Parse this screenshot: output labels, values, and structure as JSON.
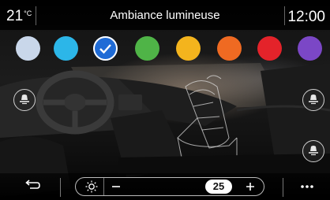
{
  "status_bar": {
    "temperature": "21",
    "temperature_unit": "°C",
    "title": "Ambiance lumineuse",
    "clock": "12:00"
  },
  "color_swatches": [
    {
      "name": "pale-blue",
      "color": "#c9d7ea",
      "selected": false
    },
    {
      "name": "cyan",
      "color": "#2cb6e8",
      "selected": false
    },
    {
      "name": "blue",
      "color": "#1f6bd6",
      "selected": true
    },
    {
      "name": "green",
      "color": "#4fb447",
      "selected": false
    },
    {
      "name": "yellow",
      "color": "#f4b41d",
      "selected": false
    },
    {
      "name": "orange",
      "color": "#ef6a22",
      "selected": false
    },
    {
      "name": "red",
      "color": "#e4232a",
      "selected": false
    },
    {
      "name": "purple",
      "color": "#7b47c6",
      "selected": false
    }
  ],
  "side_buttons": {
    "left": "ceiling-light-icon",
    "right_top": "ceiling-light-icon",
    "right_bottom": "ceiling-light-icon"
  },
  "brightness": {
    "icon": "sun-icon",
    "value": "25",
    "level": 0.25
  },
  "bottom_bar": {
    "back_icon": "back-arrow-icon",
    "minus_icon": "minus-icon",
    "plus_icon": "plus-icon",
    "more_icon": "more-icon"
  },
  "colors": {
    "accent": "#1f6bd6",
    "text": "#ffffff"
  }
}
